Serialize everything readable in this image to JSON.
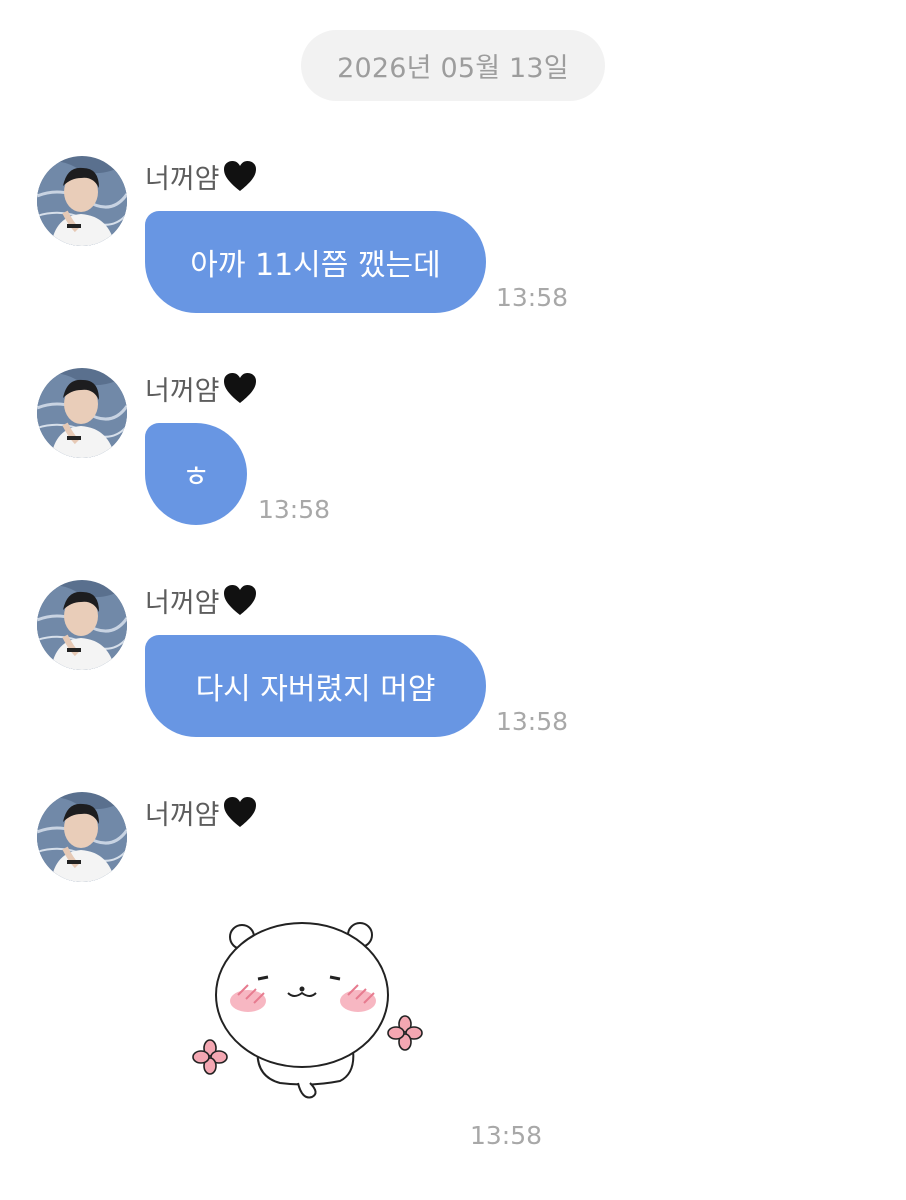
{
  "date_divider": "2026년 05월 13일",
  "messages": [
    {
      "sender": "너꺼얌",
      "text": "아까 11시쯤 깼는데",
      "time": "13:58"
    },
    {
      "sender": "너꺼얌",
      "text": "ㅎ",
      "time": "13:58"
    },
    {
      "sender": "너꺼얌",
      "text": "다시 자버렸지 머얌",
      "time": "13:58"
    },
    {
      "sender": "너꺼얌",
      "sticker": "blushing-bear-sticker",
      "time": "13:58"
    }
  ],
  "colors": {
    "bubble": "#6896e3",
    "bubble_text": "#ffffff",
    "date_pill_bg": "#f2f2f2",
    "timestamp": "#a8a8a8",
    "background": "#ffffff"
  },
  "icons": {
    "sender_suffix": "black-heart-icon"
  }
}
